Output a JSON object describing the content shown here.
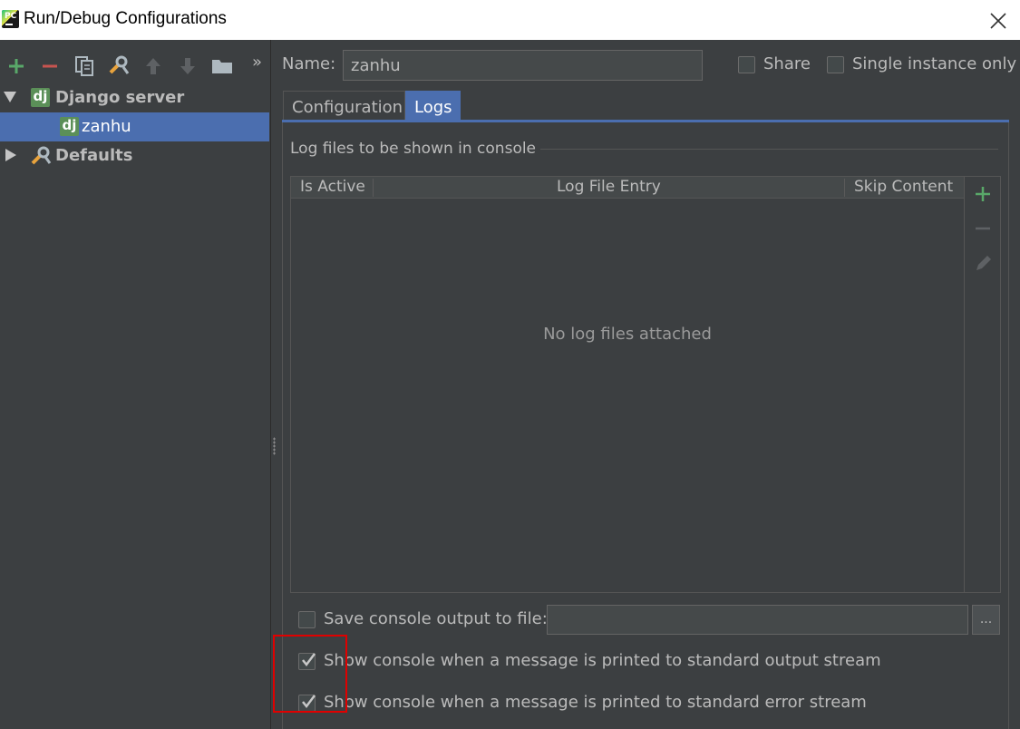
{
  "window": {
    "title": "Run/Debug Configurations",
    "app_icon_text": "PC"
  },
  "toolbar": {
    "items": [
      "add-icon",
      "remove-icon",
      "copy-icon",
      "edit-defaults-icon",
      "move-up-icon",
      "move-down-icon",
      "folder-icon",
      "more-icon"
    ],
    "more_label": "»"
  },
  "tree": {
    "group_label": "Django server",
    "group_icon_text": "dj",
    "item_label": "zanhu",
    "item_icon_text": "dj",
    "defaults_label": "Defaults"
  },
  "config": {
    "name_label": "Name:",
    "name_value": "zanhu",
    "share_label": "Share",
    "single_instance_label": "Single instance only"
  },
  "tabs": [
    {
      "label": "Configuration",
      "active": false
    },
    {
      "label": "Logs",
      "active": true
    }
  ],
  "logs": {
    "section_title": "Log files to be shown in console",
    "columns": [
      "Is Active",
      "Log File Entry",
      "Skip Content"
    ],
    "empty_text": "No log files attached",
    "save_output_label": "Save console output to file:",
    "save_output_checked": false,
    "browse_label": "...",
    "show_stdout_label": "Show console when a message is printed to standard output stream",
    "show_stdout_checked": true,
    "show_stderr_label": "Show console when a message is printed to standard error stream",
    "show_stderr_checked": true
  },
  "colors": {
    "background": "#3c3f41",
    "selection": "#4b6eaf",
    "add_green": "#59a869",
    "remove_red": "#c75450",
    "highlight_red": "#e00000"
  }
}
